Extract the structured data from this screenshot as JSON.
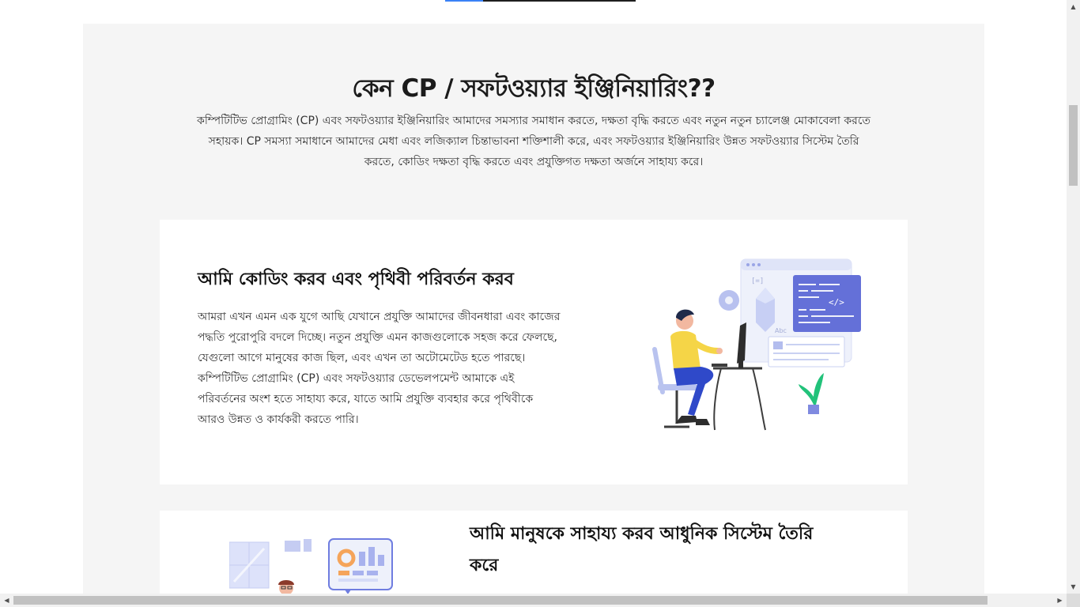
{
  "page": {
    "top_progress": 0.2
  },
  "intro": {
    "title": "কেন CP / সফটওয়্যার ইঞ্জিনিয়ারিং??",
    "description": "কম্পিটিটিভ প্রোগ্রামিং (CP) এবং সফটওয়্যার ইঞ্জিনিয়ারিং আমাদের সমস্যার সমাধান করতে, দক্ষতা বৃদ্ধি করতে এবং নতুন নতুন চ্যালেঞ্জ মোকাবেলা করতে সহায়ক। CP সমস্যা সমাধানে আমাদের মেধা এবং লজিক্যাল চিন্তাভাবনা শক্তিশালী করে, এবং সফটওয়্যার ইঞ্জিনিয়ারিং উন্নত সফটওয়্যার সিস্টেম তৈরি করতে, কোডিং দক্ষতা বৃদ্ধি করতে এবং প্রযুক্তিগত দক্ষতা অর্জনে সাহায্য করে।"
  },
  "card1": {
    "heading": "আমি কোডিং করব এবং পৃথিবী পরিবর্তন করব",
    "text": "আমরা এখন এমন এক যুগে আছি যেখানে প্রযুক্তি আমাদের জীবনধারা এবং কাজের পদ্ধতি পুরোপুরি বদলে দিচ্ছে। নতুন প্রযুক্তি এমন কাজগুলোকে সহজ করে ফেলছে, যেগুলো আগে মানুষের কাজ ছিল, এবং এখন তা অটোমেটেড হতে পারছে। কম্পিটিটিভ প্রোগ্রামিং (CP) এবং সফটওয়্যার ডেভেলপমেন্ট আমাকে এই পরিবর্তনের অংশ হতে সাহায্য করে, যাতে আমি প্রযুক্তি ব্যবহার করে পৃথিবীকে আরও উন্নত ও কার্যকরী করতে পারি।",
    "illus_code_label": "</>",
    "illus_abc_label": "Abc"
  },
  "card2": {
    "heading": "আমি মানুষকে সাহায্য করব আধুনিক সিস্টেম তৈরি করে"
  },
  "scrollbars": {
    "up_arrow": "▲",
    "down_arrow": "▼",
    "left_arrow": "◀",
    "right_arrow": "▶"
  }
}
